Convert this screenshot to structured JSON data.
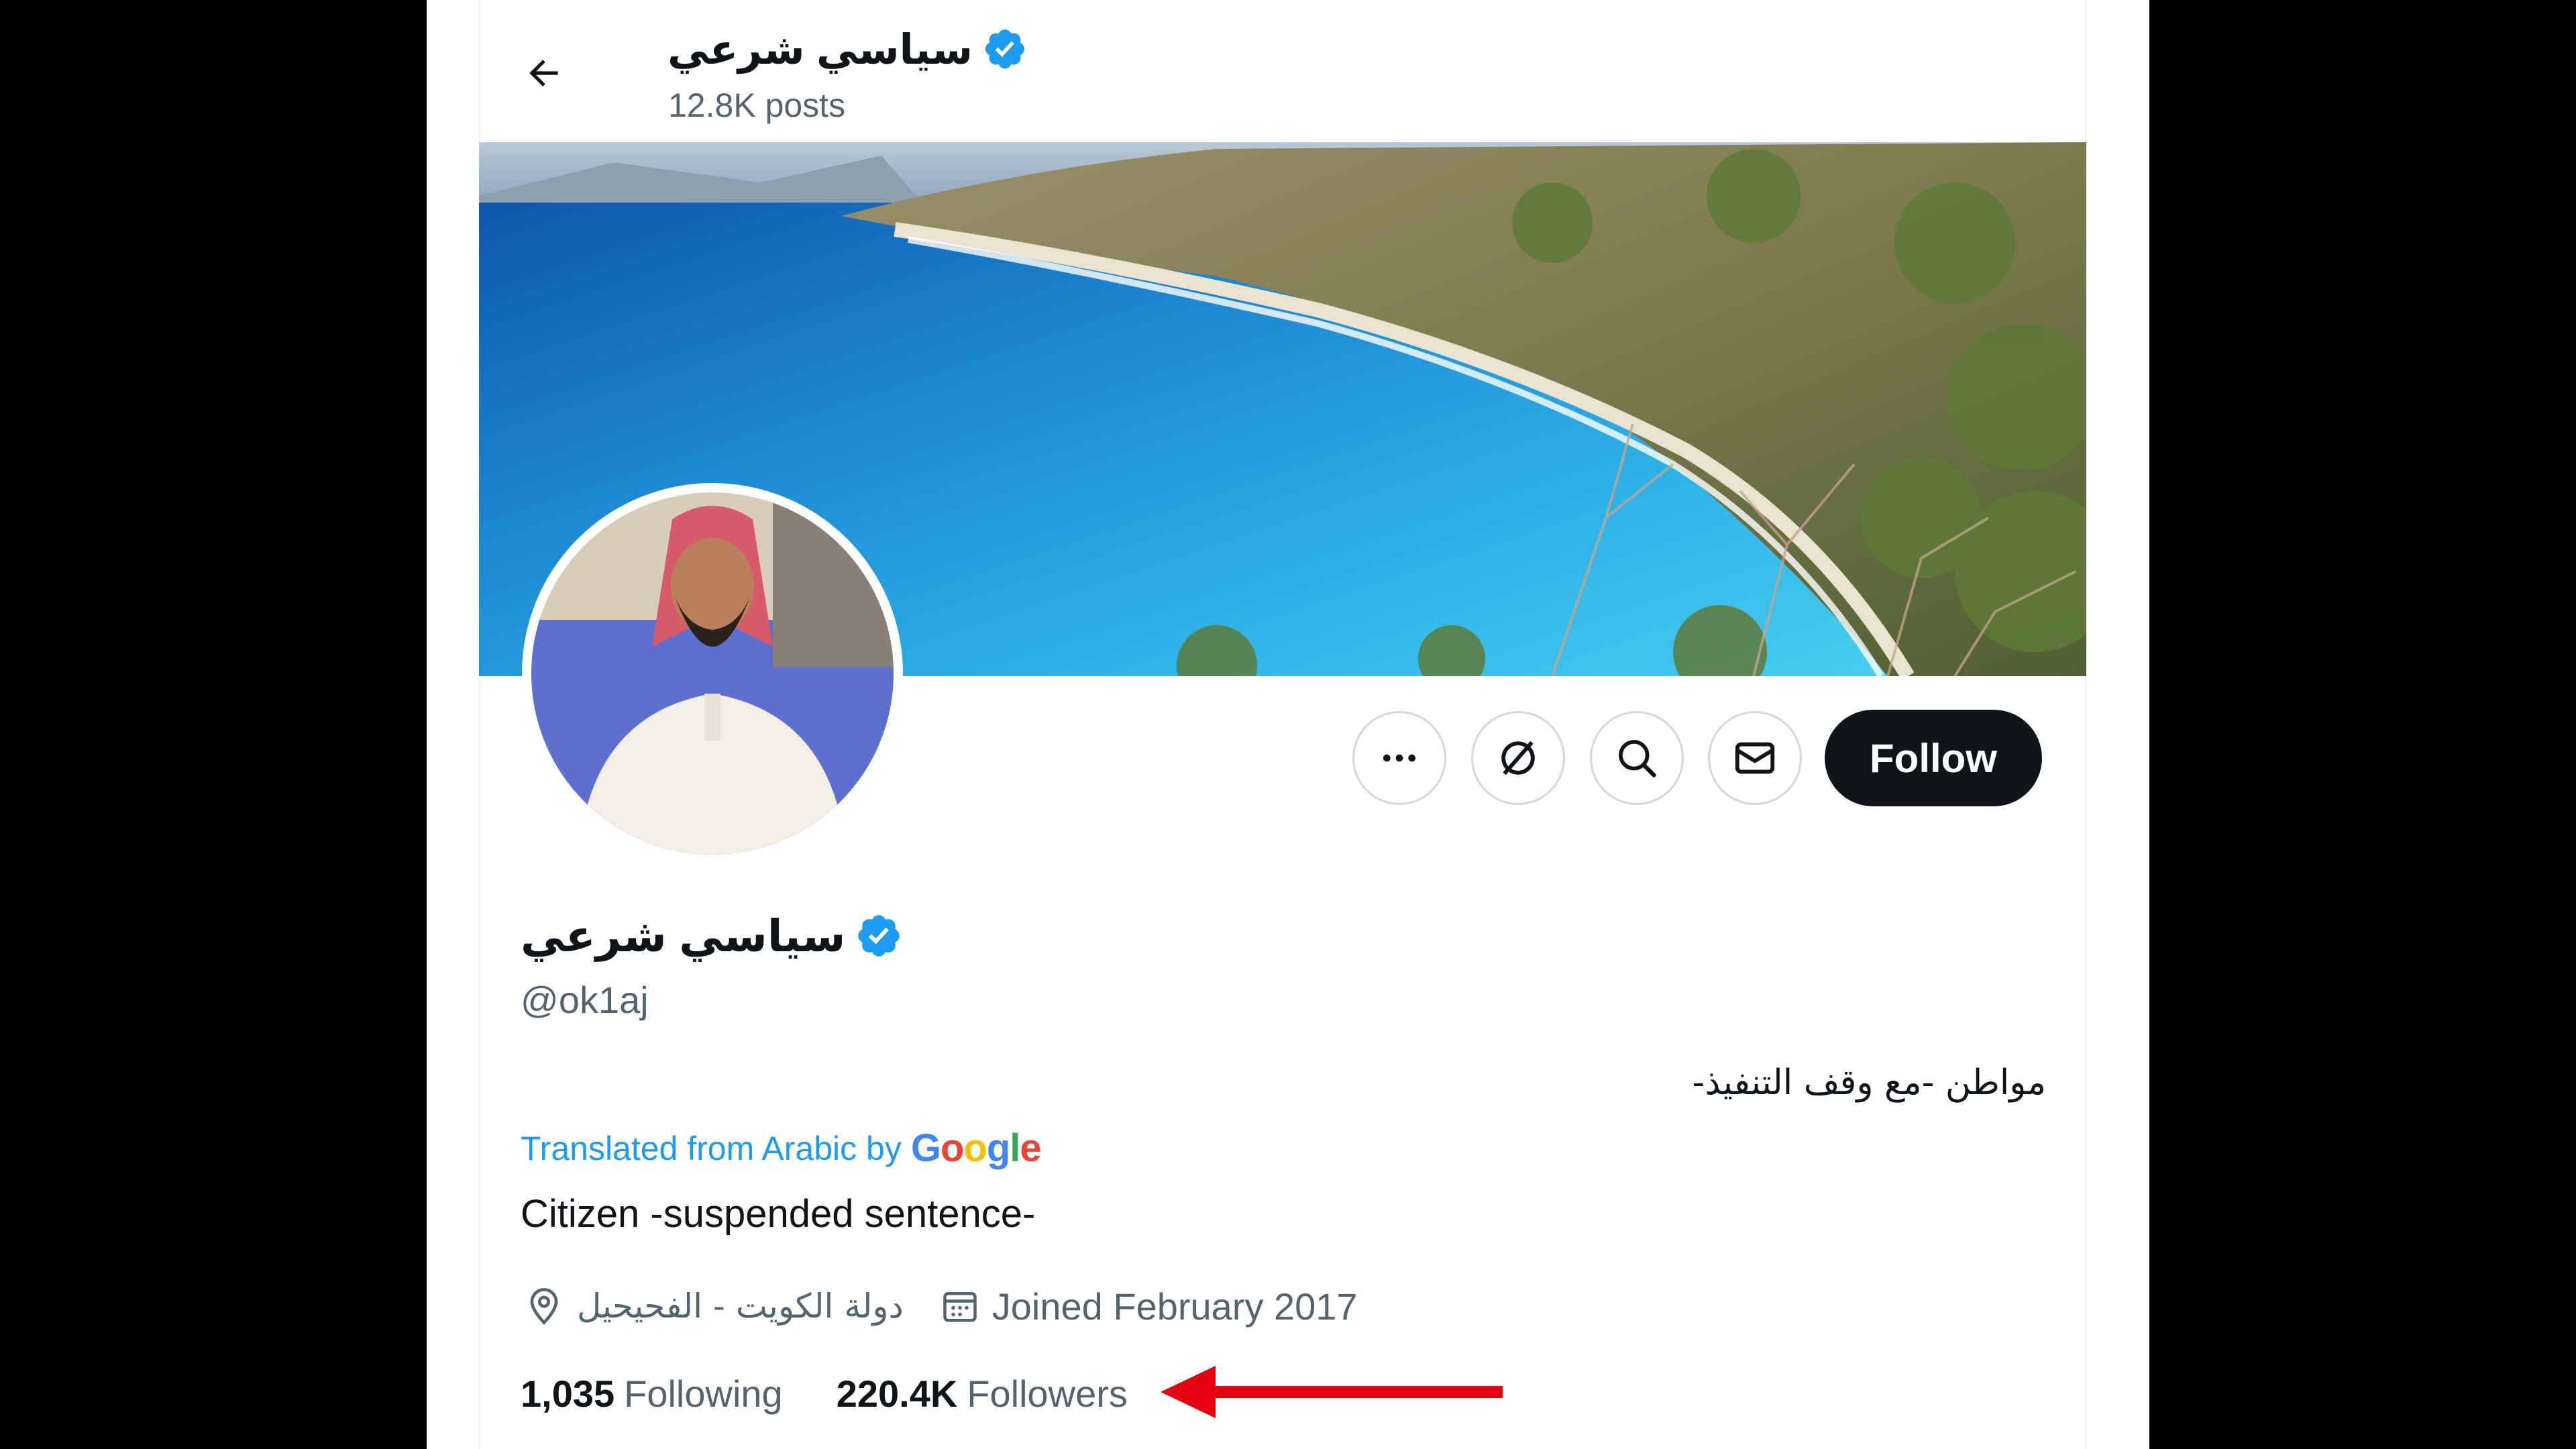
{
  "header": {
    "display_name": "سياسي شرعي",
    "posts_count": "12.8K posts"
  },
  "profile": {
    "display_name": "سياسي شرعي",
    "handle": "@ok1aj",
    "bio_original": "مواطن -مع وقف التنفيذ-",
    "translated_label": "Translated from Arabic by",
    "translation_provider": "Google",
    "bio_translated": "Citizen -suspended sentence-",
    "location": "دولة الكويت - الفحيحيل",
    "joined": "Joined February 2017",
    "following_count": "1,035",
    "following_label": "Following",
    "followers_count": "220.4K",
    "followers_label": "Followers"
  },
  "actions": {
    "follow_label": "Follow",
    "icons": [
      "more-icon",
      "grok-icon",
      "search-icon",
      "message-icon"
    ]
  },
  "colors": {
    "verified": "#1d9bf0",
    "link": "#1d9bf0",
    "follow_bg": "#0f1419",
    "annotation_arrow": "#e3000f"
  }
}
